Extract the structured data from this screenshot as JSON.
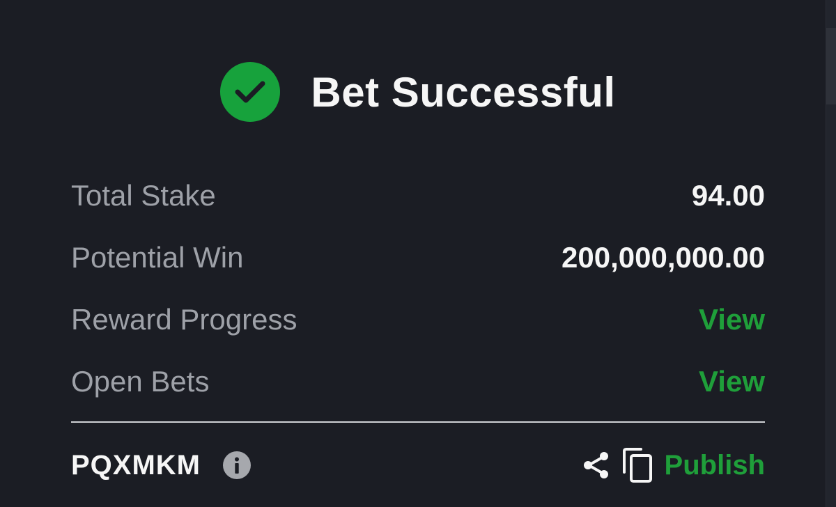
{
  "header": {
    "title": "Bet Successful",
    "icon": "check-circle-icon",
    "icon_color": "#17a23c"
  },
  "summary": {
    "total_stake": {
      "label": "Total Stake",
      "value": "94.00"
    },
    "potential_win": {
      "label": "Potential Win",
      "value": "200,000,000.00"
    },
    "reward_progress": {
      "label": "Reward Progress",
      "link": "View"
    },
    "open_bets": {
      "label": "Open Bets",
      "link": "View"
    }
  },
  "footer": {
    "booking_code": "PQXMKM",
    "info_icon": "info-icon",
    "share_icon": "share-icon",
    "copy_icon": "copy-icon",
    "publish_label": "Publish"
  },
  "colors": {
    "background": "#1b1d24",
    "accent_green": "#1f9f3a",
    "label_gray": "#9ea1a8",
    "text_white": "#f6f6f6"
  }
}
